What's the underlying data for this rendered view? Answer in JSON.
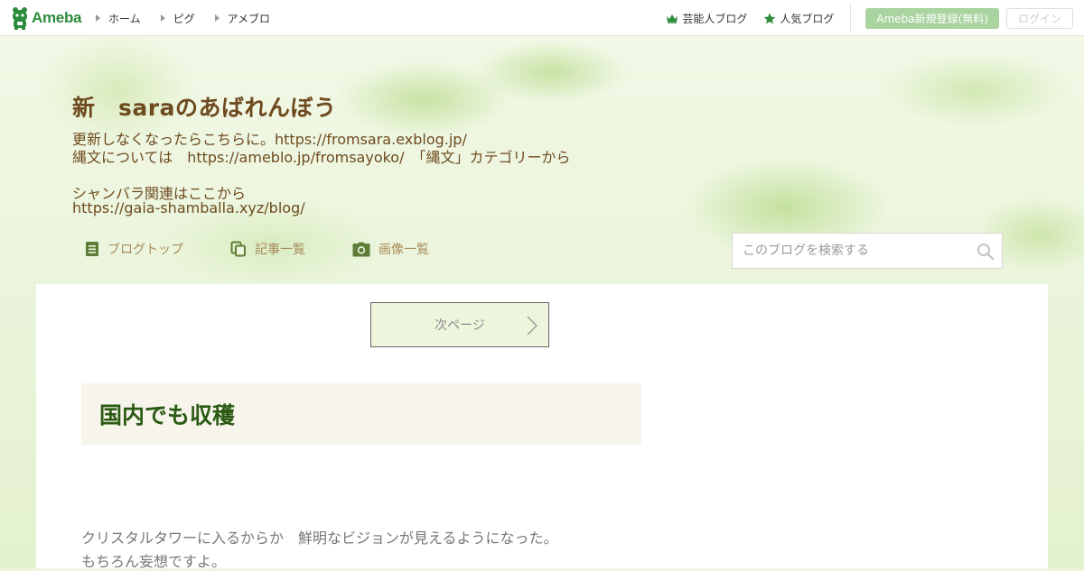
{
  "topbar": {
    "logo": "Ameba",
    "nav": [
      {
        "label": "ホーム"
      },
      {
        "label": "ピグ"
      },
      {
        "label": "アメブロ"
      }
    ],
    "celebrity_label": "芸能人ブログ",
    "popular_label": "人気ブログ",
    "register_label": "Ameba新規登録(無料)",
    "login_label": "ログイン"
  },
  "header": {
    "blog_title": "新　saraのあばれんぼう",
    "description": [
      "更新しなくなったらこちらに。https://fromsara.exblog.jp/",
      "縄文については　https://ameblo.jp/fromsayoko/　「縄文」カテゴリーから",
      "シャンバラ関連はここから",
      "https://gaia-shamballa.xyz/blog/"
    ],
    "subnav": {
      "top_label": "ブログトップ",
      "entries_label": "記事一覧",
      "images_label": "画像一覧"
    },
    "search": {
      "placeholder": "このブログを検索する"
    }
  },
  "content": {
    "next_page_label": "次ページ",
    "article_title": "国内でも収穫",
    "body_lines": [
      "クリスタルタワーに入るからか　鮮明なビジョンが見えるようになった。",
      "もちろん妄想ですよ。"
    ]
  },
  "colors": {
    "brand_green": "#2d8c3c",
    "title_brown": "#6e4a1e",
    "subnav_tan": "#a88b5c",
    "article_title_green": "#2b5a14"
  }
}
